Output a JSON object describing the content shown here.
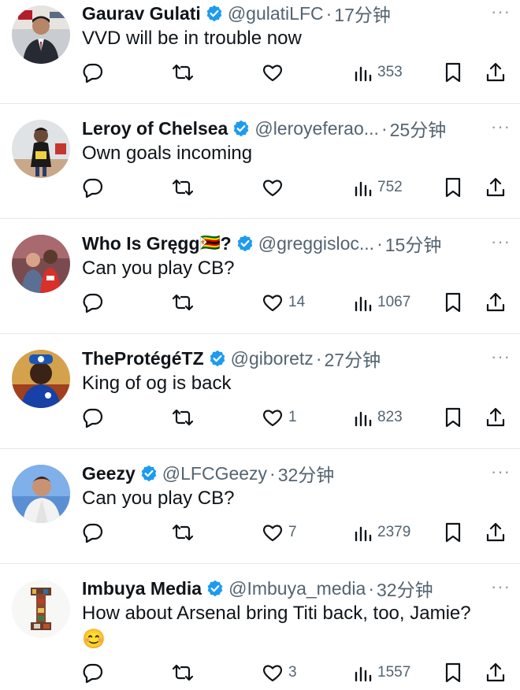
{
  "tweets": [
    {
      "name": "Gaurav Gulati",
      "handle": "@gulatiLFC",
      "time": "17分钟",
      "text": "VVD will be in trouble now",
      "likes": "",
      "views": "353"
    },
    {
      "name": "Leroy of Chelsea",
      "handle": "@leroyeferao...",
      "time": "25分钟",
      "text": "Own goals incoming",
      "likes": "",
      "views": "752"
    },
    {
      "name": "Who Is Gręgg",
      "flag": "🇿🇼",
      "question": "?",
      "handle": "@greggisloc...",
      "time": "15分钟",
      "text": "Can you play CB?",
      "likes": "14",
      "views": "1067"
    },
    {
      "name": "TheProtégéTZ",
      "handle": "@giboretz",
      "time": "27分钟",
      "text": "King of og is back",
      "likes": "1",
      "views": "823"
    },
    {
      "name": "Geezy",
      "handle": "@LFCGeezy",
      "time": "32分钟",
      "text": "Can you play CB?",
      "likes": "7",
      "views": "2379"
    },
    {
      "name": "Imbuya Media",
      "handle": "@Imbuya_media",
      "time": "32分钟",
      "text": "How about Arsenal bring Titi back, too, Jamie?",
      "emoji": "😊",
      "likes": "3",
      "views": "1557"
    }
  ],
  "separator": "·",
  "more": "···",
  "colors": {
    "verified": "#1d9bf0",
    "muted": "#536471",
    "text": "#0f1419",
    "divider": "#e6e9ec"
  }
}
